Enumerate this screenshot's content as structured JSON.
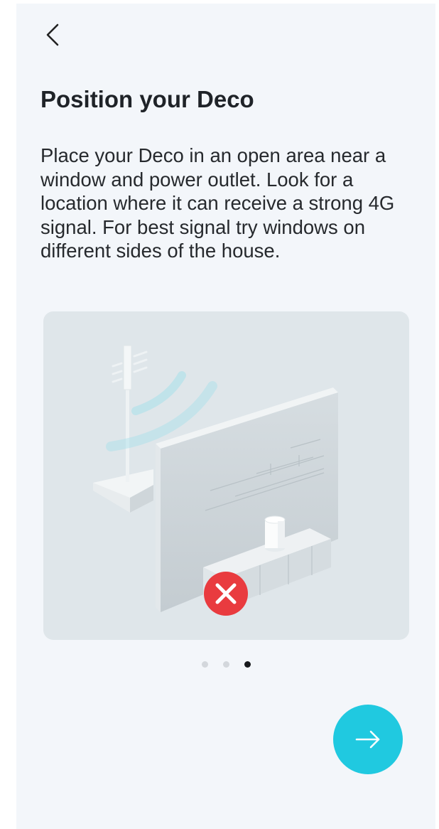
{
  "header": {
    "back_icon": "chevron-left-icon"
  },
  "content": {
    "title": "Position your Deco",
    "description": "Place your Deco in an open area near a window and power outlet. Look for a location where it can receive a strong 4G signal. For best signal try windows on different sides of the house."
  },
  "illustration": {
    "subject": "antenna-wall-deco-scene",
    "status_icon": "x-mark-icon",
    "status_color": "#e93b3f"
  },
  "pagination": {
    "total": 3,
    "current": 3
  },
  "footer": {
    "next_icon": "arrow-right-icon",
    "next_color": "#20c9e0"
  }
}
